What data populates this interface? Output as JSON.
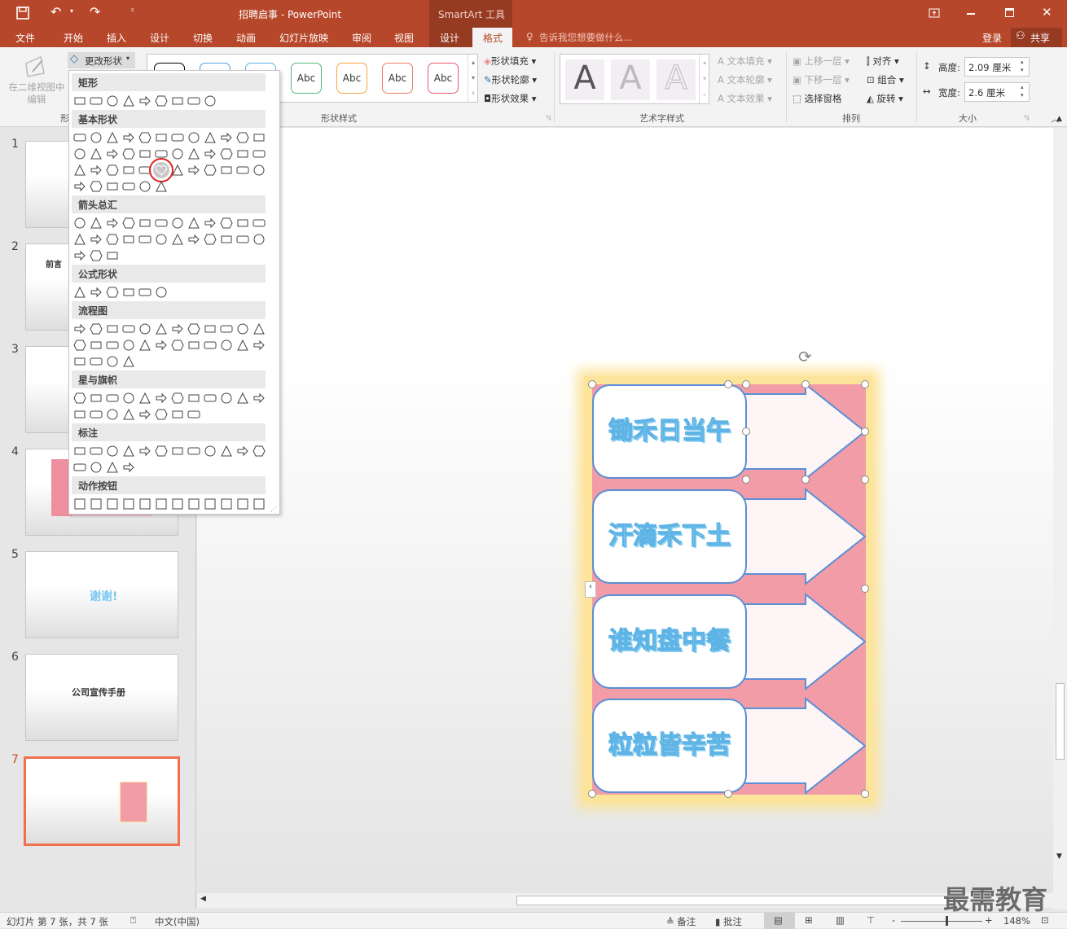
{
  "app": {
    "title": "招聘启事 - PowerPoint",
    "context_tab_group": "SmartArt 工具",
    "accent": "#b7472a"
  },
  "qat": {
    "save": "save-icon",
    "undo": "undo-icon",
    "redo": "redo-icon",
    "customize": "customize-icon"
  },
  "window": {
    "ribbon_display": "ribbon-display-icon",
    "minimize": "minimize-icon",
    "maximize": "maximize-icon",
    "close": "close-icon"
  },
  "tabs": [
    "文件",
    "开始",
    "插入",
    "设计",
    "切换",
    "动画",
    "幻灯片放映",
    "审阅",
    "视图",
    "设计",
    "格式"
  ],
  "active_tab": "格式",
  "tell_me": "告诉我您想要做什么...",
  "signin": "登录",
  "share": "共享",
  "ribbon": {
    "edit2d": "在二维视图中编辑",
    "change_shape": "更改形状",
    "group_shapes_label": "形",
    "shape_styles_label": "形状样式",
    "abc": "Abc",
    "style_colors": [
      "#000000",
      "#5b9bd5",
      "#5bb5e0",
      "#4fb878",
      "#f5a742",
      "#ee7b5e",
      "#e8586e"
    ],
    "shape_fill": "形状填充",
    "shape_outline": "形状轮廓",
    "shape_effects": "形状效果",
    "wordart_label": "艺术字样式",
    "wordart_letter": "A",
    "text_fill": "文本填充",
    "text_outline": "文本轮廓",
    "text_effects": "文本效果",
    "arrange_label": "排列",
    "bring_forward": "上移一层",
    "send_backward": "下移一层",
    "selection_pane": "选择窗格",
    "align": "对齐",
    "group": "组合",
    "rotate": "旋转",
    "size_label": "大小",
    "height_label": "高度:",
    "height_value": "2.09 厘米",
    "width_label": "宽度:",
    "width_value": "2.6 厘米"
  },
  "dropdown": {
    "categories": [
      {
        "label": "矩形",
        "rows": [
          9
        ]
      },
      {
        "label": "基本形状",
        "rows": [
          12,
          12,
          12,
          6
        ],
        "selected": "heart"
      },
      {
        "label": "箭头总汇",
        "rows": [
          12,
          12,
          3
        ]
      },
      {
        "label": "公式形状",
        "rows": [
          6
        ]
      },
      {
        "label": "流程图",
        "rows": [
          12,
          12,
          4
        ]
      },
      {
        "label": "星与旗帜",
        "rows": [
          12,
          8
        ]
      },
      {
        "label": "标注",
        "rows": [
          12,
          4
        ]
      },
      {
        "label": "动作按钮",
        "rows": [
          12
        ]
      }
    ]
  },
  "slides": [
    {
      "num": "1",
      "title": ""
    },
    {
      "num": "2",
      "title": "前言"
    },
    {
      "num": "3",
      "title": ""
    },
    {
      "num": "4",
      "title": ""
    },
    {
      "num": "5",
      "title": "谢谢!"
    },
    {
      "num": "6",
      "title": "公司宣传手册"
    },
    {
      "num": "7",
      "title": ""
    }
  ],
  "current_slide": "7",
  "smartart": {
    "items": [
      "锄禾日当午",
      "汗滴禾下土",
      "谁知盘中餐",
      "粒粒皆辛苦"
    ],
    "bg_color": "#f19ca7",
    "border_color": "#5b8fd6",
    "arrow_fill": "#fdf5f6"
  },
  "status": {
    "slide_info": "幻灯片 第 7 张，共 7 张",
    "language": "中文(中国)",
    "notes": "备注",
    "comments": "批注",
    "zoom": "148%"
  },
  "watermark": "最需教育"
}
